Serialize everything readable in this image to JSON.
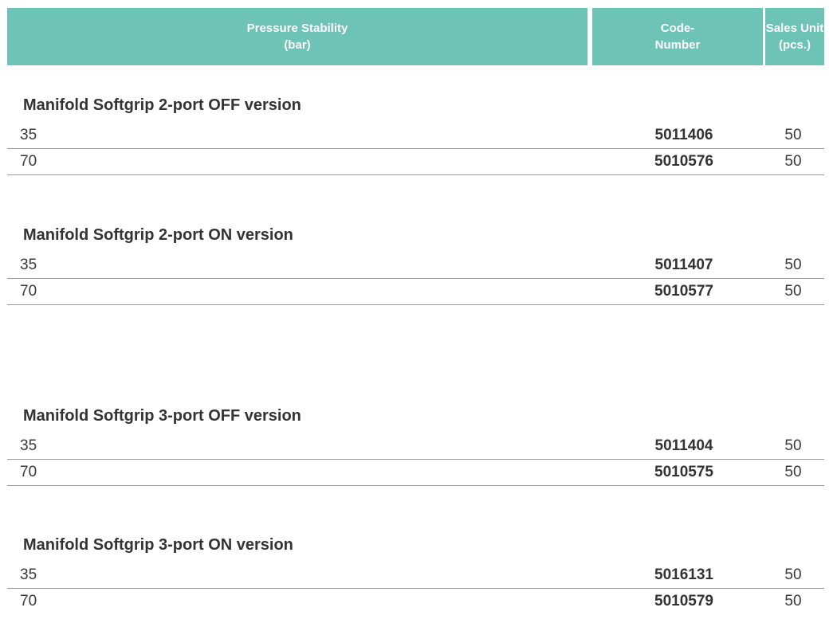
{
  "header": {
    "col_pressure": "Pressure Stability\n(bar)",
    "col_code": "Code-\nNumber",
    "col_sales": "Sales Unit\n(pcs.)"
  },
  "sections": [
    {
      "title": "Manifold Softgrip 2-port OFF version",
      "rows": [
        {
          "pressure": "35",
          "code": "5011406",
          "sales": "50"
        },
        {
          "pressure": "70",
          "code": "5010576",
          "sales": "50"
        }
      ]
    },
    {
      "title": "Manifold Softgrip 2-port ON version",
      "rows": [
        {
          "pressure": "35",
          "code": "5011407",
          "sales": "50"
        },
        {
          "pressure": "70",
          "code": "5010577",
          "sales": "50"
        }
      ]
    },
    {
      "title": "Manifold Softgrip 3-port OFF version",
      "rows": [
        {
          "pressure": "35",
          "code": "5011404",
          "sales": "50"
        },
        {
          "pressure": "70",
          "code": "5010575",
          "sales": "50"
        }
      ]
    },
    {
      "title": "Manifold Softgrip 3-port ON version",
      "rows": [
        {
          "pressure": "35",
          "code": "5016131",
          "sales": "50"
        },
        {
          "pressure": "70",
          "code": "5010579",
          "sales": "50"
        }
      ]
    }
  ]
}
